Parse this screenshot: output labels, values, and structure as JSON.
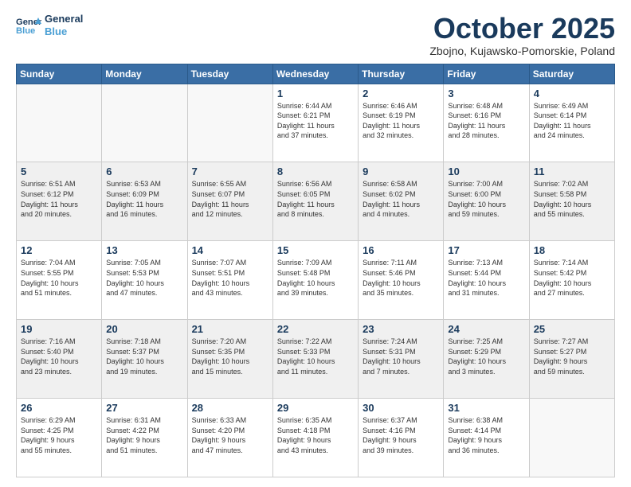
{
  "logo": {
    "line1": "General",
    "line2": "Blue"
  },
  "title": "October 2025",
  "location": "Zbojno, Kujawsko-Pomorskie, Poland",
  "headers": [
    "Sunday",
    "Monday",
    "Tuesday",
    "Wednesday",
    "Thursday",
    "Friday",
    "Saturday"
  ],
  "weeks": [
    [
      {
        "day": "",
        "text": ""
      },
      {
        "day": "",
        "text": ""
      },
      {
        "day": "",
        "text": ""
      },
      {
        "day": "1",
        "text": "Sunrise: 6:44 AM\nSunset: 6:21 PM\nDaylight: 11 hours\nand 37 minutes."
      },
      {
        "day": "2",
        "text": "Sunrise: 6:46 AM\nSunset: 6:19 PM\nDaylight: 11 hours\nand 32 minutes."
      },
      {
        "day": "3",
        "text": "Sunrise: 6:48 AM\nSunset: 6:16 PM\nDaylight: 11 hours\nand 28 minutes."
      },
      {
        "day": "4",
        "text": "Sunrise: 6:49 AM\nSunset: 6:14 PM\nDaylight: 11 hours\nand 24 minutes."
      }
    ],
    [
      {
        "day": "5",
        "text": "Sunrise: 6:51 AM\nSunset: 6:12 PM\nDaylight: 11 hours\nand 20 minutes."
      },
      {
        "day": "6",
        "text": "Sunrise: 6:53 AM\nSunset: 6:09 PM\nDaylight: 11 hours\nand 16 minutes."
      },
      {
        "day": "7",
        "text": "Sunrise: 6:55 AM\nSunset: 6:07 PM\nDaylight: 11 hours\nand 12 minutes."
      },
      {
        "day": "8",
        "text": "Sunrise: 6:56 AM\nSunset: 6:05 PM\nDaylight: 11 hours\nand 8 minutes."
      },
      {
        "day": "9",
        "text": "Sunrise: 6:58 AM\nSunset: 6:02 PM\nDaylight: 11 hours\nand 4 minutes."
      },
      {
        "day": "10",
        "text": "Sunrise: 7:00 AM\nSunset: 6:00 PM\nDaylight: 10 hours\nand 59 minutes."
      },
      {
        "day": "11",
        "text": "Sunrise: 7:02 AM\nSunset: 5:58 PM\nDaylight: 10 hours\nand 55 minutes."
      }
    ],
    [
      {
        "day": "12",
        "text": "Sunrise: 7:04 AM\nSunset: 5:55 PM\nDaylight: 10 hours\nand 51 minutes."
      },
      {
        "day": "13",
        "text": "Sunrise: 7:05 AM\nSunset: 5:53 PM\nDaylight: 10 hours\nand 47 minutes."
      },
      {
        "day": "14",
        "text": "Sunrise: 7:07 AM\nSunset: 5:51 PM\nDaylight: 10 hours\nand 43 minutes."
      },
      {
        "day": "15",
        "text": "Sunrise: 7:09 AM\nSunset: 5:48 PM\nDaylight: 10 hours\nand 39 minutes."
      },
      {
        "day": "16",
        "text": "Sunrise: 7:11 AM\nSunset: 5:46 PM\nDaylight: 10 hours\nand 35 minutes."
      },
      {
        "day": "17",
        "text": "Sunrise: 7:13 AM\nSunset: 5:44 PM\nDaylight: 10 hours\nand 31 minutes."
      },
      {
        "day": "18",
        "text": "Sunrise: 7:14 AM\nSunset: 5:42 PM\nDaylight: 10 hours\nand 27 minutes."
      }
    ],
    [
      {
        "day": "19",
        "text": "Sunrise: 7:16 AM\nSunset: 5:40 PM\nDaylight: 10 hours\nand 23 minutes."
      },
      {
        "day": "20",
        "text": "Sunrise: 7:18 AM\nSunset: 5:37 PM\nDaylight: 10 hours\nand 19 minutes."
      },
      {
        "day": "21",
        "text": "Sunrise: 7:20 AM\nSunset: 5:35 PM\nDaylight: 10 hours\nand 15 minutes."
      },
      {
        "day": "22",
        "text": "Sunrise: 7:22 AM\nSunset: 5:33 PM\nDaylight: 10 hours\nand 11 minutes."
      },
      {
        "day": "23",
        "text": "Sunrise: 7:24 AM\nSunset: 5:31 PM\nDaylight: 10 hours\nand 7 minutes."
      },
      {
        "day": "24",
        "text": "Sunrise: 7:25 AM\nSunset: 5:29 PM\nDaylight: 10 hours\nand 3 minutes."
      },
      {
        "day": "25",
        "text": "Sunrise: 7:27 AM\nSunset: 5:27 PM\nDaylight: 9 hours\nand 59 minutes."
      }
    ],
    [
      {
        "day": "26",
        "text": "Sunrise: 6:29 AM\nSunset: 4:25 PM\nDaylight: 9 hours\nand 55 minutes."
      },
      {
        "day": "27",
        "text": "Sunrise: 6:31 AM\nSunset: 4:22 PM\nDaylight: 9 hours\nand 51 minutes."
      },
      {
        "day": "28",
        "text": "Sunrise: 6:33 AM\nSunset: 4:20 PM\nDaylight: 9 hours\nand 47 minutes."
      },
      {
        "day": "29",
        "text": "Sunrise: 6:35 AM\nSunset: 4:18 PM\nDaylight: 9 hours\nand 43 minutes."
      },
      {
        "day": "30",
        "text": "Sunrise: 6:37 AM\nSunset: 4:16 PM\nDaylight: 9 hours\nand 39 minutes."
      },
      {
        "day": "31",
        "text": "Sunrise: 6:38 AM\nSunset: 4:14 PM\nDaylight: 9 hours\nand 36 minutes."
      },
      {
        "day": "",
        "text": ""
      }
    ]
  ]
}
